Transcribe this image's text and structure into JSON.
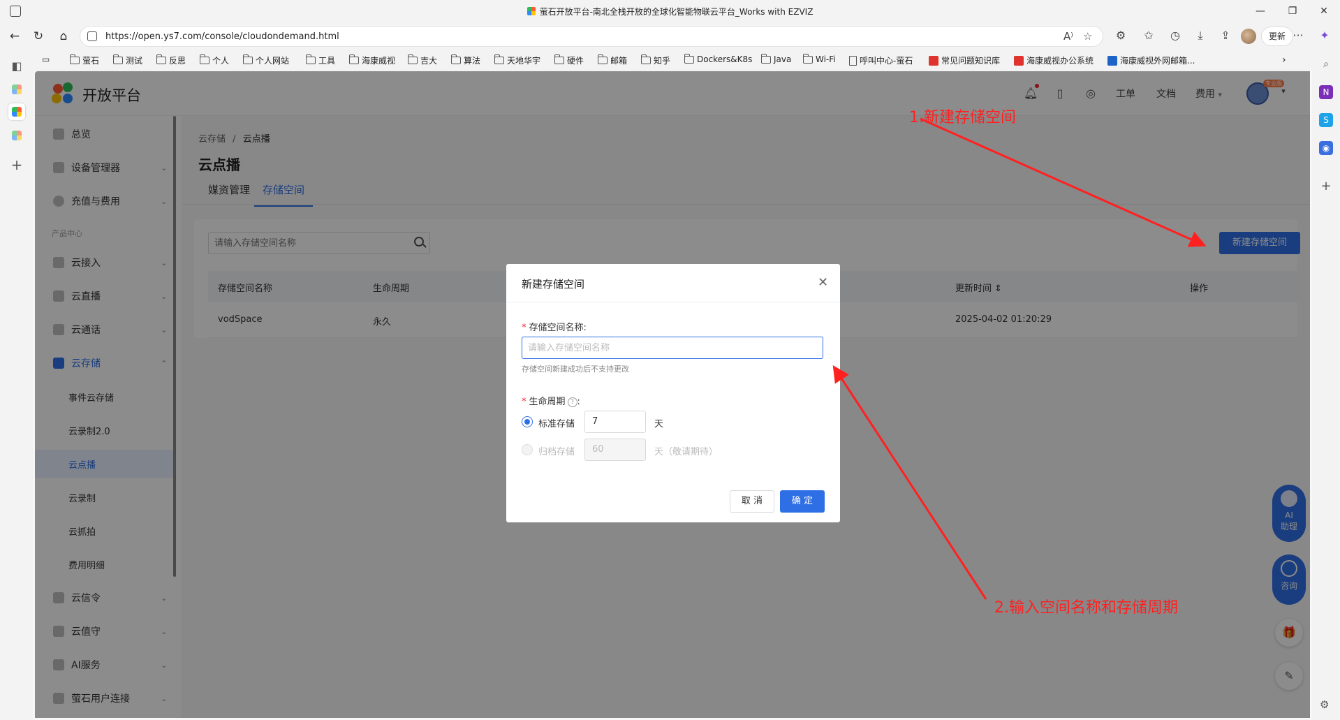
{
  "window": {
    "title": "萤石开放平台-南北全栈开放的全球化智能物联云平台_Works with EZVIZ",
    "minimize": "—",
    "maximize": "❐",
    "close": "✕"
  },
  "addressbar": {
    "back": "←",
    "refresh": "↻",
    "home": "⌂",
    "url": "https://open.ys7.com/console/cloudondemand.html",
    "read_aloud": "A⁾",
    "favorite": "☆",
    "update_label": "更新",
    "more": "···"
  },
  "bookmarks": [
    {
      "label": "萤石",
      "icon": "folder-icon"
    },
    {
      "label": "测试",
      "icon": "folder-icon"
    },
    {
      "label": "反思",
      "icon": "folder-icon"
    },
    {
      "label": "个人",
      "icon": "folder-icon"
    },
    {
      "label": "个人网站",
      "icon": "folder-icon"
    },
    {
      "label": "工具",
      "icon": "folder-icon"
    },
    {
      "label": "海康威视",
      "icon": "folder-icon"
    },
    {
      "label": "吉大",
      "icon": "folder-icon"
    },
    {
      "label": "算法",
      "icon": "folder-icon"
    },
    {
      "label": "天地华宇",
      "icon": "folder-icon"
    },
    {
      "label": "硬件",
      "icon": "folder-icon"
    },
    {
      "label": "邮箱",
      "icon": "folder-icon"
    },
    {
      "label": "知乎",
      "icon": "folder-icon"
    },
    {
      "label": "Dockers&K8s",
      "icon": "folder-icon"
    },
    {
      "label": "Java",
      "icon": "folder-icon"
    },
    {
      "label": "Wi-Fi",
      "icon": "folder-icon"
    },
    {
      "label": "呼叫中心-萤石",
      "icon": "page-icon"
    },
    {
      "label": "常见问题知识库",
      "icon": "red-badge-icon"
    },
    {
      "label": "海康威视办公系统",
      "icon": "red-badge-icon"
    },
    {
      "label": "海康威视外网邮箱...",
      "icon": "outlook-icon"
    }
  ],
  "header": {
    "brand": "开放平台",
    "links": [
      "工单",
      "文档",
      "费用"
    ],
    "fee_caret": "▾",
    "user_tag": "专业版"
  },
  "sidebar": {
    "items": [
      {
        "label": "总览",
        "chev": ""
      },
      {
        "label": "设备管理器",
        "chev": "⌄"
      },
      {
        "label": "充值与费用",
        "chev": "⌄"
      }
    ],
    "section": "产品中心",
    "products": [
      {
        "label": "云接入",
        "chev": "⌄"
      },
      {
        "label": "云直播",
        "chev": "⌄"
      },
      {
        "label": "云通话",
        "chev": "⌄"
      },
      {
        "label": "云存储",
        "chev": "⌃"
      }
    ],
    "storage_sub": [
      "事件云存储",
      "云录制2.0",
      "云点播",
      "云录制",
      "云抓拍",
      "费用明细"
    ],
    "more": [
      {
        "label": "云信令",
        "chev": "⌄"
      },
      {
        "label": "云值守",
        "chev": "⌄"
      },
      {
        "label": "AI服务",
        "chev": "⌄"
      },
      {
        "label": "萤石用户连接",
        "chev": "⌄"
      }
    ]
  },
  "main": {
    "breadcrumb_parent": "云存储",
    "breadcrumb_sep": "/",
    "breadcrumb_current": "云点播",
    "title": "云点播",
    "tabs": [
      "媒资管理",
      "存储空间"
    ],
    "search_placeholder": "请输入存储空间名称",
    "create_button": "新建存储空间",
    "table": {
      "columns": [
        "存储空间名称",
        "生命周期",
        "更新时间",
        "操作"
      ],
      "sort_icon": "⇕",
      "rows": [
        {
          "name": "vodSpace",
          "lifecycle": "永久",
          "updated": "2025-04-02 01:20:29"
        }
      ]
    }
  },
  "modal": {
    "title": "新建存储空间",
    "close": "✕",
    "required_mark": "*",
    "name_label": "存储空间名称:",
    "name_placeholder": "请输入存储空间名称",
    "name_value": "",
    "name_hint": "存储空间新建成功后不支持更改",
    "lifecycle_label": "生命周期",
    "lifecycle_colon": ":",
    "help": "?",
    "standard_label": "标准存储",
    "standard_days": "7",
    "archive_label": "归档存储",
    "archive_days": "60",
    "unit_day": "天",
    "archive_unit": "天（敬请期待）",
    "cancel": "取 消",
    "confirm": "确 定"
  },
  "floating": {
    "ai": "AI\n助理",
    "consult": "咨询",
    "gift": "🎁",
    "note": "✎"
  },
  "annotations": {
    "step1": "1.新建存储空间",
    "step2": "2.输入空间名称和存储周期",
    "color": "#ff2020"
  },
  "colors": {
    "primary": "#2f6fe5",
    "danger": "#f5222d"
  }
}
